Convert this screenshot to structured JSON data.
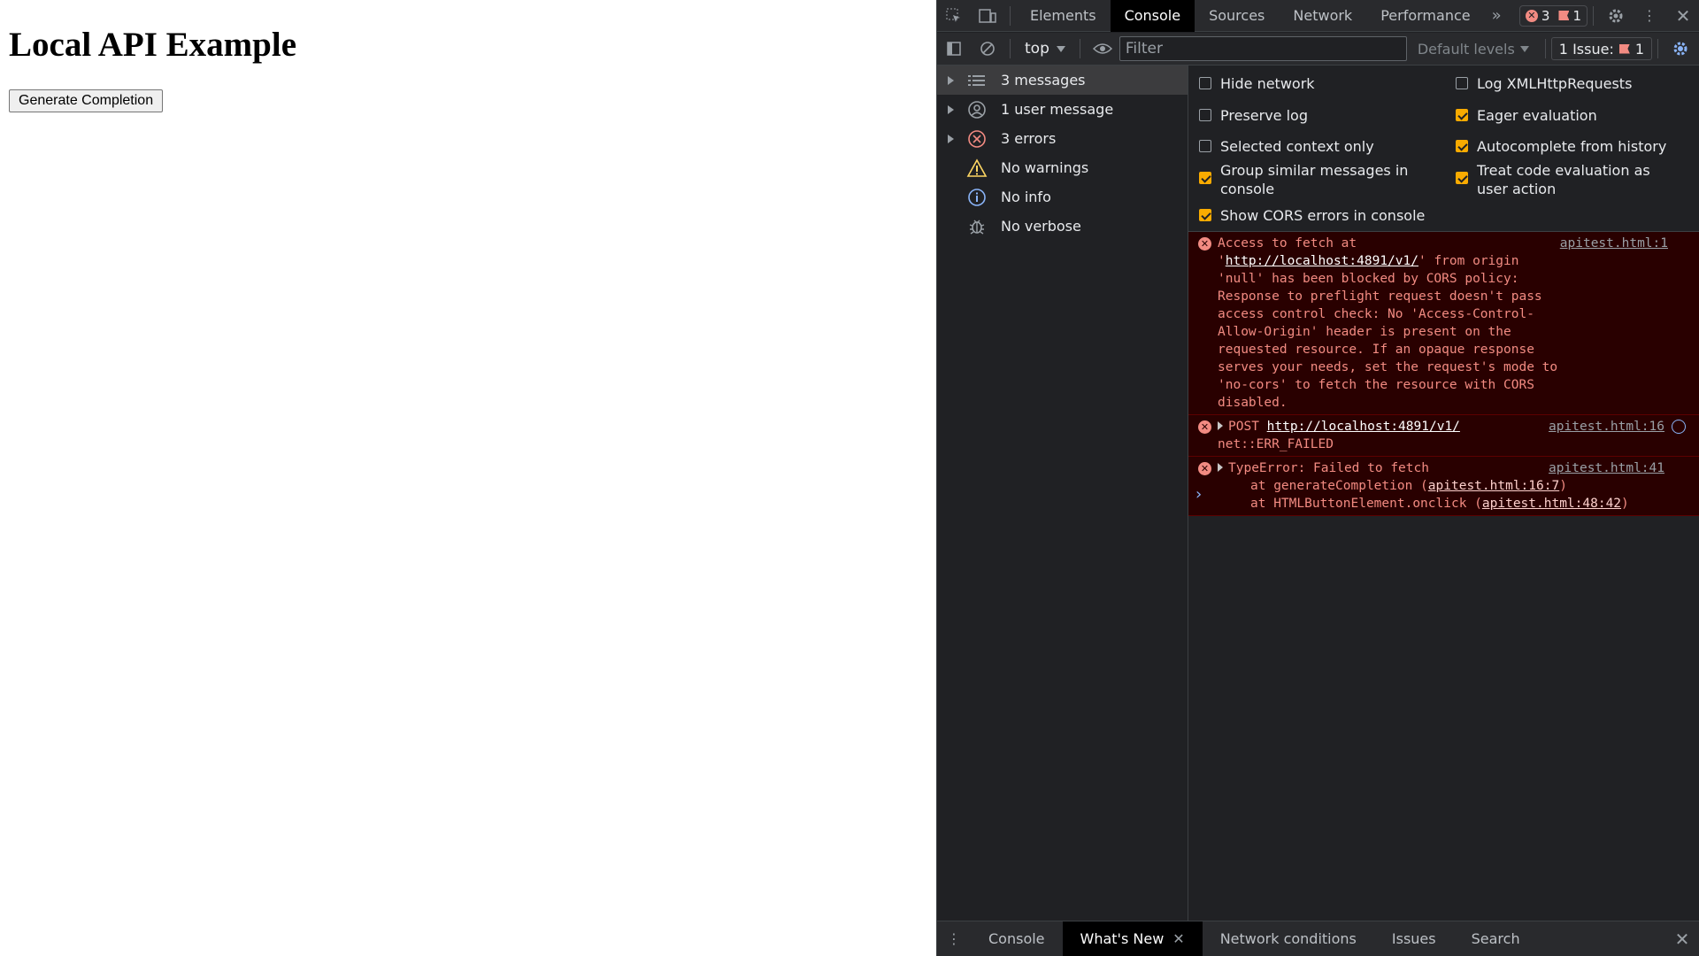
{
  "page": {
    "heading": "Local API Example",
    "button_label": "Generate Completion"
  },
  "devtools": {
    "tabs": [
      "Elements",
      "Console",
      "Sources",
      "Network",
      "Performance"
    ],
    "active_tab": "Console",
    "error_count": "3",
    "issue_count": "1",
    "toolbar": {
      "context": "top",
      "filter_placeholder": "Filter",
      "levels_label": "Default levels",
      "issues_label": "1 Issue:",
      "issues_count": "1"
    },
    "sidebar": [
      {
        "label": "3 messages",
        "icon": "list-icon",
        "expandable": true
      },
      {
        "label": "1 user message",
        "icon": "user-icon",
        "expandable": true
      },
      {
        "label": "3 errors",
        "icon": "error-icon",
        "expandable": true
      },
      {
        "label": "No warnings",
        "icon": "warning-icon",
        "expandable": false
      },
      {
        "label": "No info",
        "icon": "info-icon",
        "expandable": false
      },
      {
        "label": "No verbose",
        "icon": "bug-icon",
        "expandable": false
      }
    ],
    "settings": {
      "hide_network": {
        "label": "Hide network",
        "checked": false
      },
      "preserve_log": {
        "label": "Preserve log",
        "checked": false
      },
      "selected_context": {
        "label": "Selected context only",
        "checked": false
      },
      "group_similar": {
        "label": "Group similar messages in console",
        "checked": true
      },
      "show_cors": {
        "label": "Show CORS errors in console",
        "checked": true
      },
      "log_xhr": {
        "label": "Log XMLHttpRequests",
        "checked": false
      },
      "eager_eval": {
        "label": "Eager evaluation",
        "checked": true
      },
      "autocomplete": {
        "label": "Autocomplete from history",
        "checked": true
      },
      "treat_code": {
        "label": "Treat code evaluation as user action",
        "checked": true
      }
    },
    "messages": {
      "cors": {
        "prefix": "Access to fetch at '",
        "url": "http://localhost:4891/v1/",
        "text": "' from origin 'null' has been blocked by CORS policy: Response to preflight request doesn't pass access control check: No 'Access-Control-Allow-Origin' header is present on the requested resource. If an opaque response serves your needs, set the request's mode to 'no-cors' to fetch the resource with CORS disabled.",
        "source": "apitest.html:1"
      },
      "post": {
        "method": "POST",
        "url": "http://localhost:4891/v1/",
        "error": "net::ERR_FAILED",
        "source": "apitest.html:16"
      },
      "typeerror": {
        "text": "TypeError: Failed to fetch",
        "frame1_prefix": "at generateCompletion (",
        "frame1_link": "apitest.html:16:7",
        "frame2_prefix": "at HTMLButtonElement.onclick (",
        "frame2_link": "apitest.html:48:42",
        "source": "apitest.html:41"
      }
    },
    "drawer": {
      "tabs": [
        "Console",
        "What's New",
        "Network conditions",
        "Issues",
        "Search"
      ],
      "active": "What's New"
    }
  }
}
